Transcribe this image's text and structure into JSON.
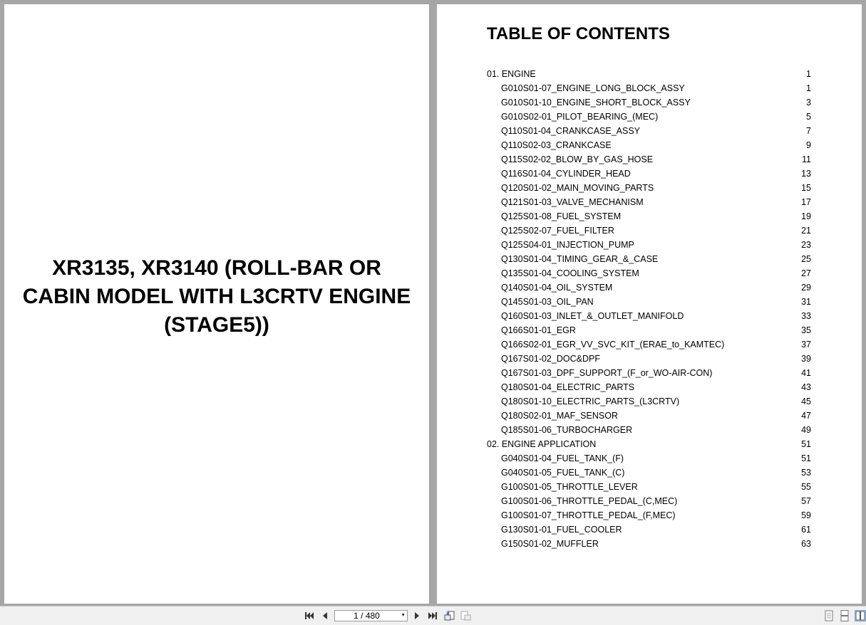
{
  "cover": {
    "title_lines": [
      "XR3135, XR3140 (ROLL-BAR OR",
      "CABIN MODEL WITH L3CRTV ENGINE",
      "(STAGE5))"
    ]
  },
  "toc": {
    "heading": "TABLE OF CONTENTS",
    "entries": [
      {
        "label": "01. ENGINE",
        "page": "1",
        "level": 0
      },
      {
        "label": "G010S01-07_ENGINE_LONG_BLOCK_ASSY",
        "page": "1",
        "level": 1
      },
      {
        "label": "G010S01-10_ENGINE_SHORT_BLOCK_ASSY",
        "page": "3",
        "level": 1
      },
      {
        "label": "G010S02-01_PILOT_BEARING_(MEC)",
        "page": "5",
        "level": 1
      },
      {
        "label": "Q110S01-04_CRANKCASE_ASSY",
        "page": "7",
        "level": 1
      },
      {
        "label": "Q110S02-03_CRANKCASE",
        "page": "9",
        "level": 1
      },
      {
        "label": "Q115S02-02_BLOW_BY_GAS_HOSE",
        "page": "11",
        "level": 1
      },
      {
        "label": "Q116S01-04_CYLINDER_HEAD",
        "page": "13",
        "level": 1
      },
      {
        "label": "Q120S01-02_MAIN_MOVING_PARTS",
        "page": "15",
        "level": 1
      },
      {
        "label": "Q121S01-03_VALVE_MECHANISM",
        "page": "17",
        "level": 1
      },
      {
        "label": "Q125S01-08_FUEL_SYSTEM",
        "page": "19",
        "level": 1
      },
      {
        "label": "Q125S02-07_FUEL_FILTER",
        "page": "21",
        "level": 1
      },
      {
        "label": "Q125S04-01_INJECTION_PUMP",
        "page": "23",
        "level": 1
      },
      {
        "label": "Q130S01-04_TIMING_GEAR_&_CASE",
        "page": "25",
        "level": 1
      },
      {
        "label": "Q135S01-04_COOLING_SYSTEM",
        "page": "27",
        "level": 1
      },
      {
        "label": "Q140S01-04_OIL_SYSTEM",
        "page": "29",
        "level": 1
      },
      {
        "label": "Q145S01-03_OIL_PAN",
        "page": "31",
        "level": 1
      },
      {
        "label": "Q160S01-03_INLET_&_OUTLET_MANIFOLD",
        "page": "33",
        "level": 1
      },
      {
        "label": "Q166S01-01_EGR",
        "page": "35",
        "level": 1
      },
      {
        "label": "Q166S02-01_EGR_VV_SVC_KIT_(ERAE_to_KAMTEC)",
        "page": "37",
        "level": 1
      },
      {
        "label": "Q167S01-02_DOC&DPF",
        "page": "39",
        "level": 1
      },
      {
        "label": "Q167S01-03_DPF_SUPPORT_(F_or_WO-AIR-CON)",
        "page": "41",
        "level": 1
      },
      {
        "label": "Q180S01-04_ELECTRIC_PARTS",
        "page": "43",
        "level": 1
      },
      {
        "label": "Q180S01-10_ELECTRIC_PARTS_(L3CRTV)",
        "page": "45",
        "level": 1
      },
      {
        "label": "Q180S02-01_MAF_SENSOR",
        "page": "47",
        "level": 1
      },
      {
        "label": "Q185S01-06_TURBOCHARGER",
        "page": "49",
        "level": 1
      },
      {
        "label": "02. ENGINE APPLICATION",
        "page": "51",
        "level": 0
      },
      {
        "label": "G040S01-04_FUEL_TANK_(F)",
        "page": "51",
        "level": 1
      },
      {
        "label": "G040S01-05_FUEL_TANK_(C)",
        "page": "53",
        "level": 1
      },
      {
        "label": "G100S01-05_THROTTLE_LEVER",
        "page": "55",
        "level": 1
      },
      {
        "label": "G100S01-06_THROTTLE_PEDAL_(C,MEC)",
        "page": "57",
        "level": 1
      },
      {
        "label": "G100S01-07_THROTTLE_PEDAL_(F,MEC)",
        "page": "59",
        "level": 1
      },
      {
        "label": "G130S01-01_FUEL_COOLER",
        "page": "61",
        "level": 1
      },
      {
        "label": "G150S01-02_MUFFLER",
        "page": "63",
        "level": 1
      }
    ]
  },
  "toolbar": {
    "page_indicator": "1 / 480",
    "icons": [
      "first-page-icon",
      "previous-page-icon",
      "next-page-icon",
      "last-page-icon",
      "go-back-icon",
      "go-forward-icon",
      "single-page-view-icon",
      "continuous-view-icon",
      "two-page-view-icon"
    ],
    "accent": "#7aa7dc"
  }
}
